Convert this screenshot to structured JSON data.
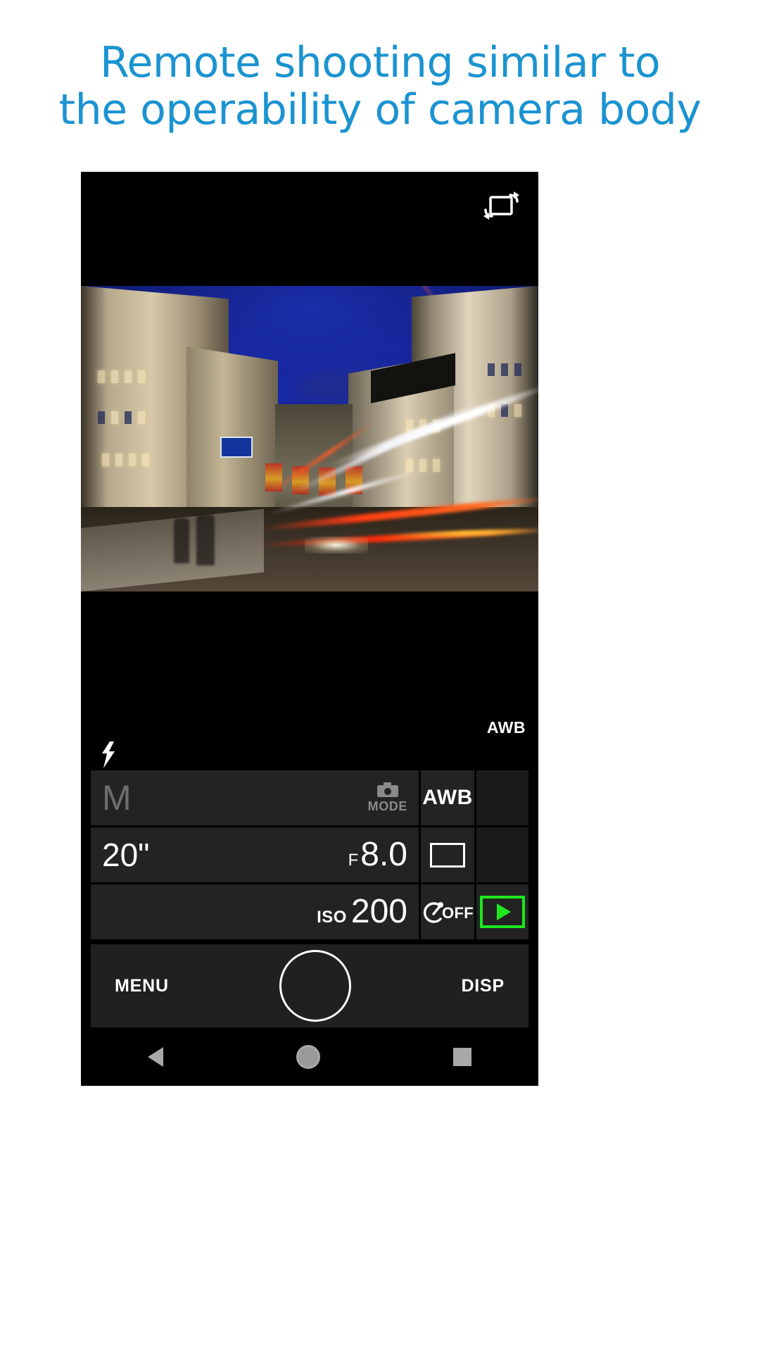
{
  "headline": {
    "line1": "Remote shooting similar to",
    "line2": "the operability of camera body",
    "color": "#1b93d1"
  },
  "app": {
    "topbar": {
      "rotate_icon": "rotate-screen-icon"
    },
    "liveview": {
      "scene_description": "Night city street with light trails",
      "overlay_awb": "AWB",
      "flash_icon": "flash-icon"
    },
    "controls": {
      "row1": {
        "mode_value": "M",
        "mode_icon": "camera-icon",
        "mode_label": "MODE",
        "white_balance": "AWB"
      },
      "row2": {
        "shutter_speed": "20\"",
        "aperture_prefix": "F",
        "aperture_value": "8.0",
        "aspect_icon": "aspect-ratio-icon"
      },
      "row3": {
        "iso_prefix": "ISO",
        "iso_value": "200",
        "timer_icon": "self-timer-icon",
        "timer_state": "OFF",
        "playback_icon": "playback-play-icon",
        "playback_color": "#1de81d"
      }
    },
    "actionbar": {
      "menu_label": "MENU",
      "shutter_label": "shutter-button",
      "disp_label": "DISP"
    },
    "navbar": {
      "back": "back-triangle-icon",
      "home": "home-circle-icon",
      "recents": "recents-square-icon"
    }
  }
}
